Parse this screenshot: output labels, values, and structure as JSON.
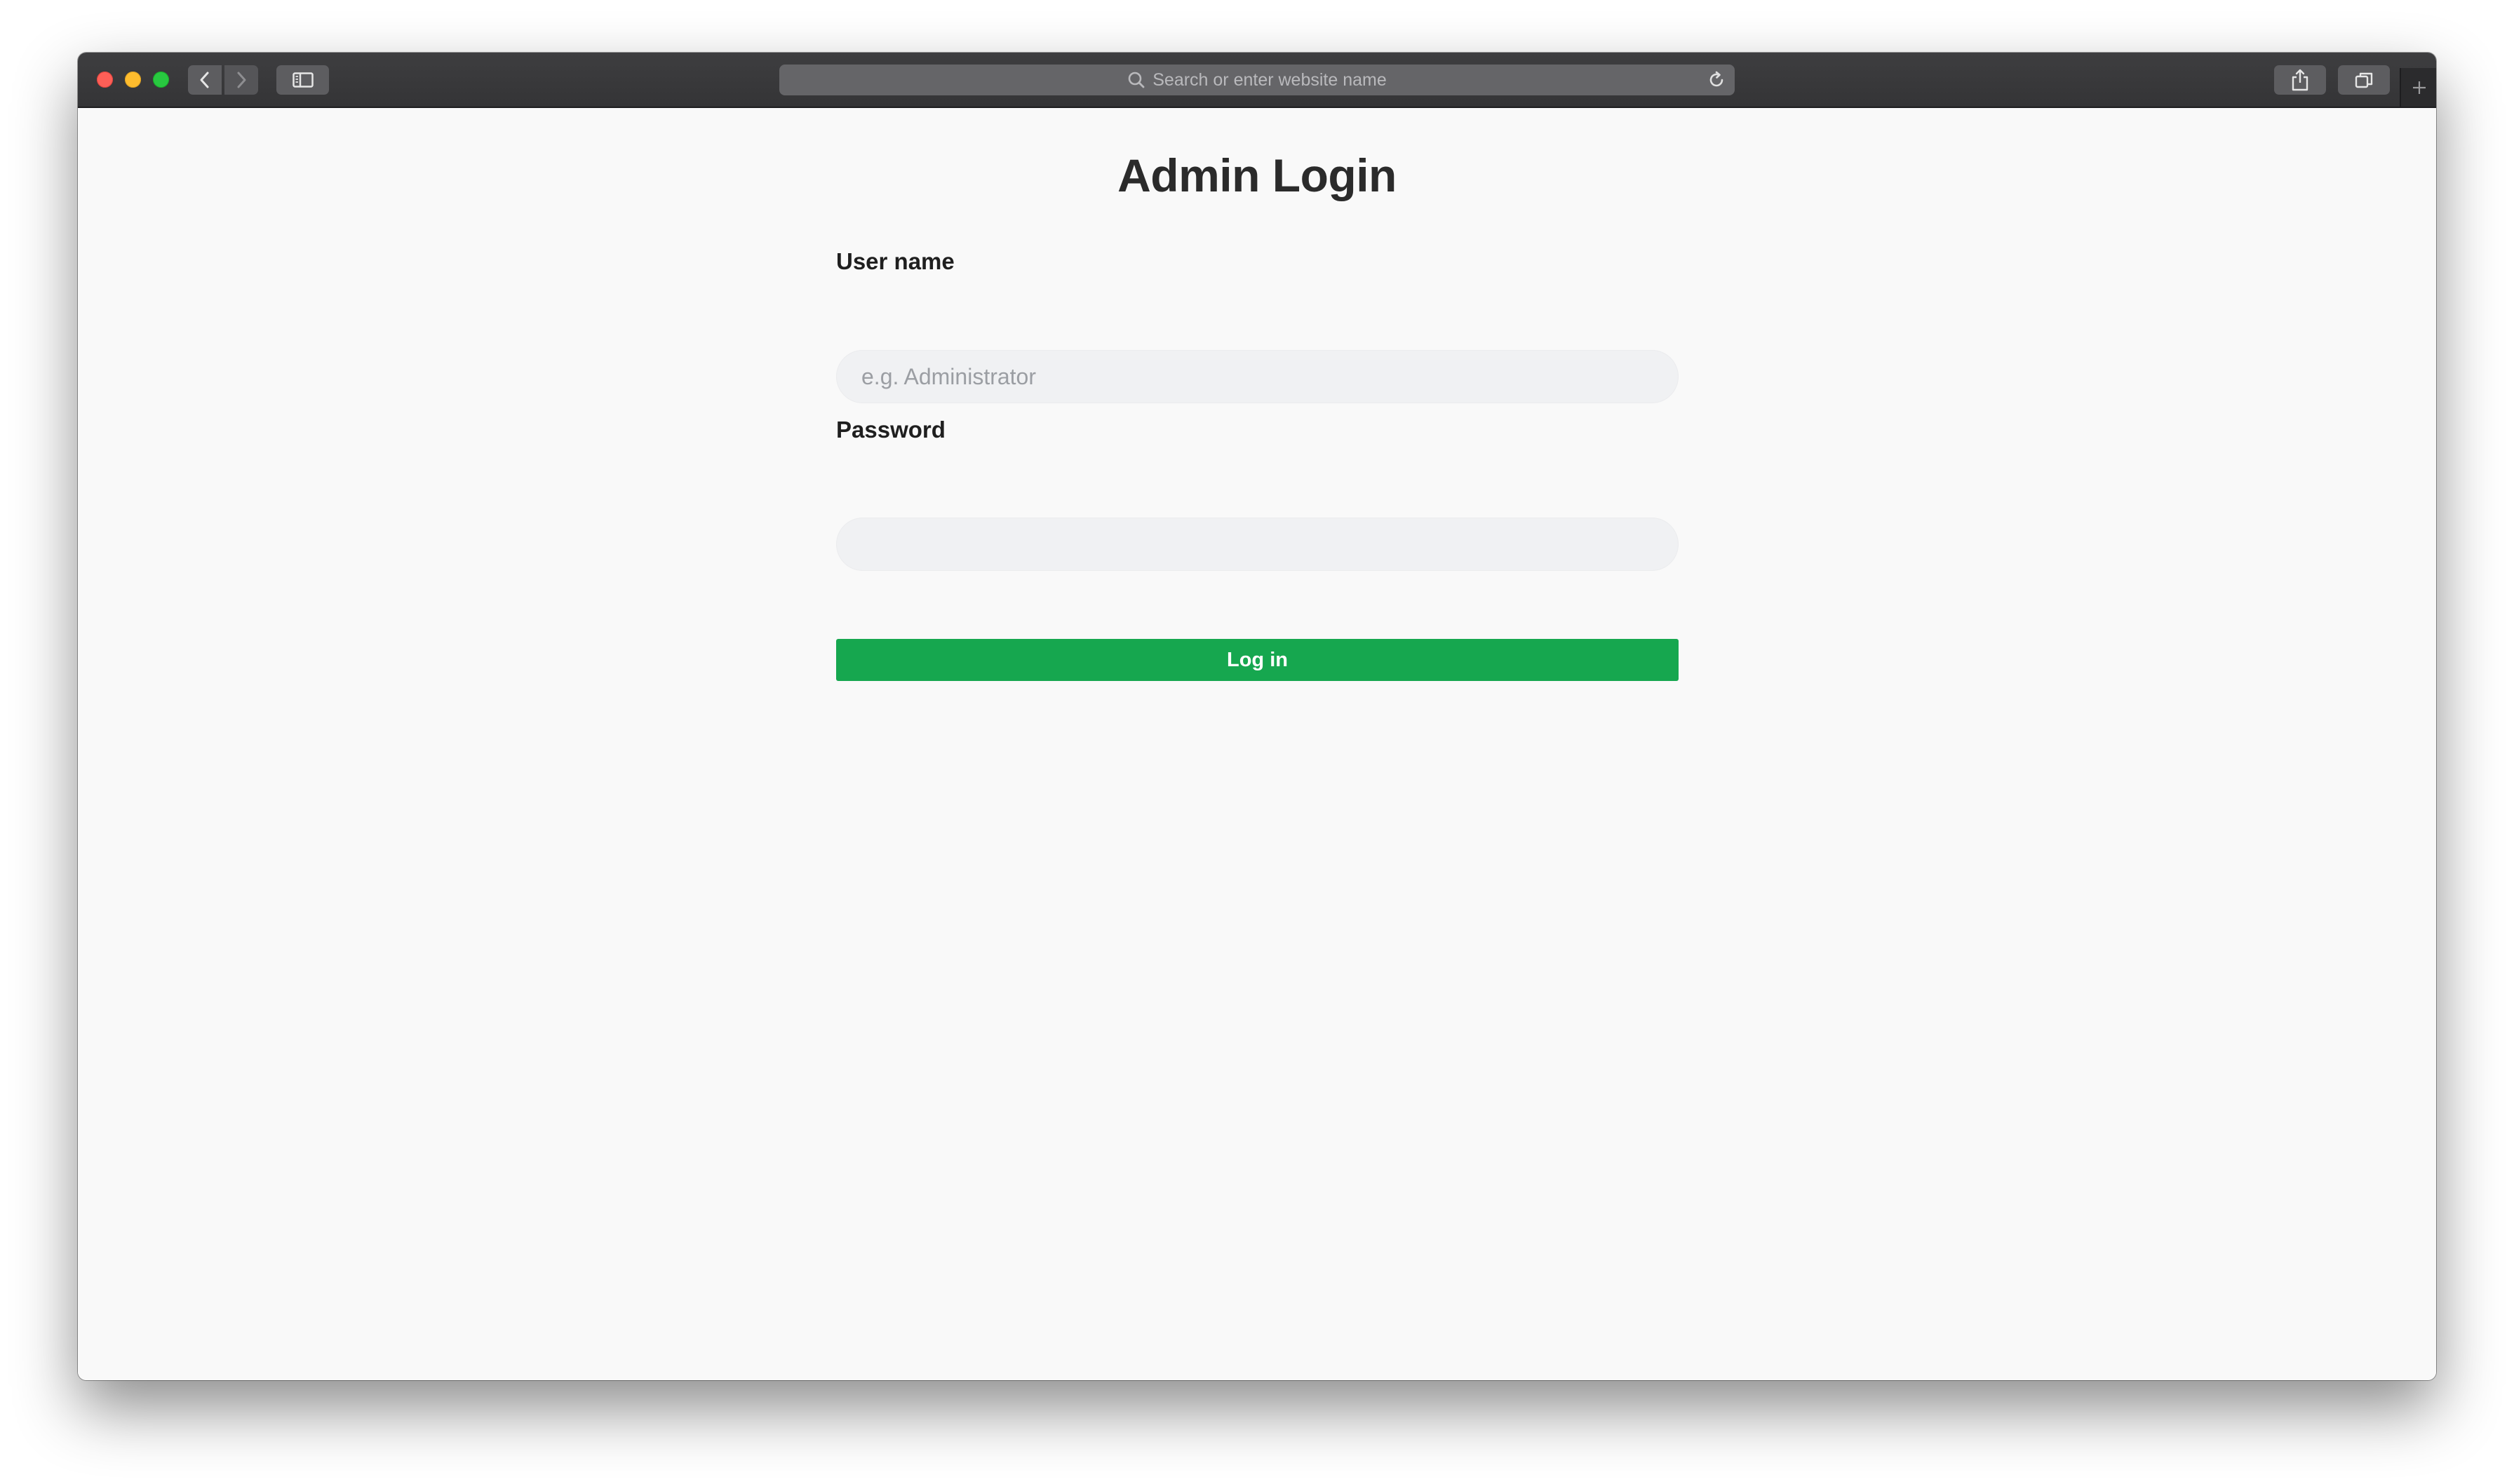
{
  "browser": {
    "address_placeholder": "Search or enter website name"
  },
  "page": {
    "title": "Admin Login"
  },
  "form": {
    "username_label": "User name",
    "username_placeholder": "e.g. Administrator",
    "username_value": "",
    "password_label": "Password",
    "password_value": "",
    "submit_label": "Log in"
  },
  "colors": {
    "accent": "#16a74f",
    "input_bg": "#f0f1f3",
    "page_bg": "#f9f9f9",
    "toolbar_bg": "#3a3a3c"
  },
  "icons": [
    "back-arrow-icon",
    "forward-arrow-icon",
    "sidebar-icon",
    "search-icon",
    "reload-icon",
    "share-icon",
    "tabs-overview-icon",
    "plus-icon"
  ]
}
